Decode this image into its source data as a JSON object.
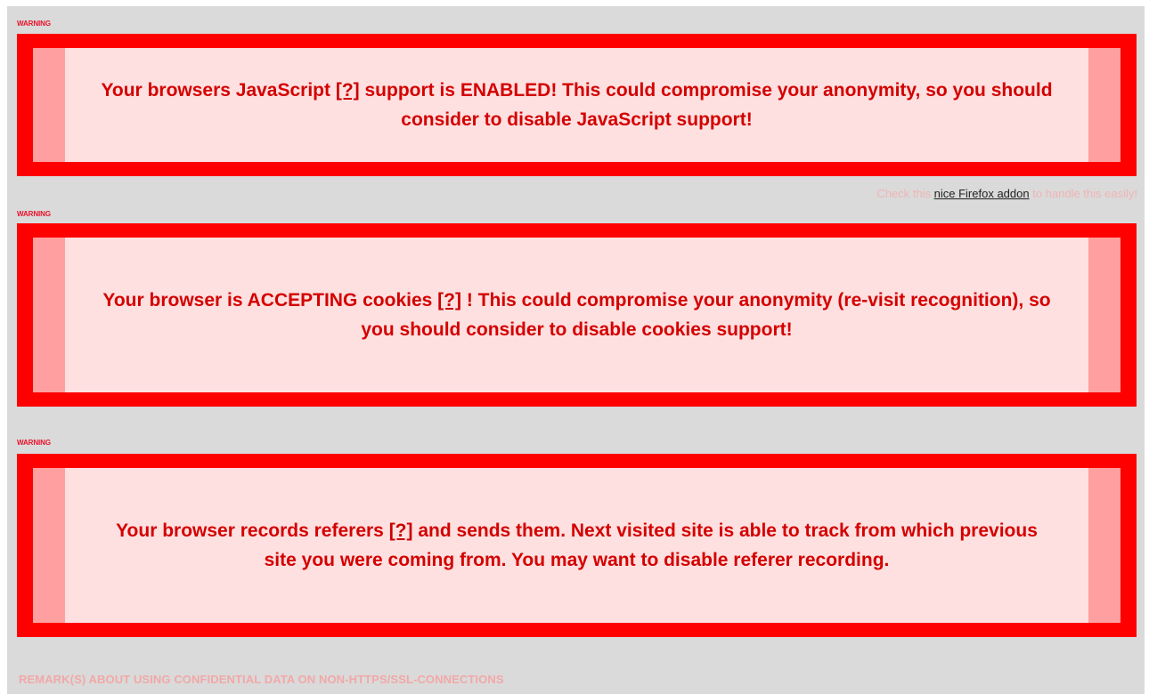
{
  "warnings": [
    {
      "label": "WARNING",
      "before": "Your browsers JavaScript ",
      "link": "[?]",
      "after": " support is ENABLED! This could compromise your anonymity, so you should consider to disable JavaScript support!"
    },
    {
      "label": "WARNING",
      "before": "Your browser is ACCEPTING cookies ",
      "link": "[?]",
      "after": " ! This could compromise your anonymity (re-visit recognition), so you should consider to disable cookies support!"
    },
    {
      "label": "WARNING",
      "before": "Your browser records referers ",
      "link": "[?]",
      "after": " and sends them. Next visited site is able to track from which previous site you were coming from. You may want to disable referer recording."
    }
  ],
  "addon": {
    "prefix": "Check this ",
    "link": "nice Firefox addon",
    "suffix": " to handle this easily!"
  },
  "remark": "REMARK(S) ABOUT USING CONFIDENTIAL DATA ON NON-HTTPS/SSL-CONNECTIONS",
  "colors": {
    "frame": "#ff0000",
    "inner": "#ffe0e0",
    "edge": "#ff9f9f",
    "text": "#d40000",
    "background": "#dadada"
  }
}
